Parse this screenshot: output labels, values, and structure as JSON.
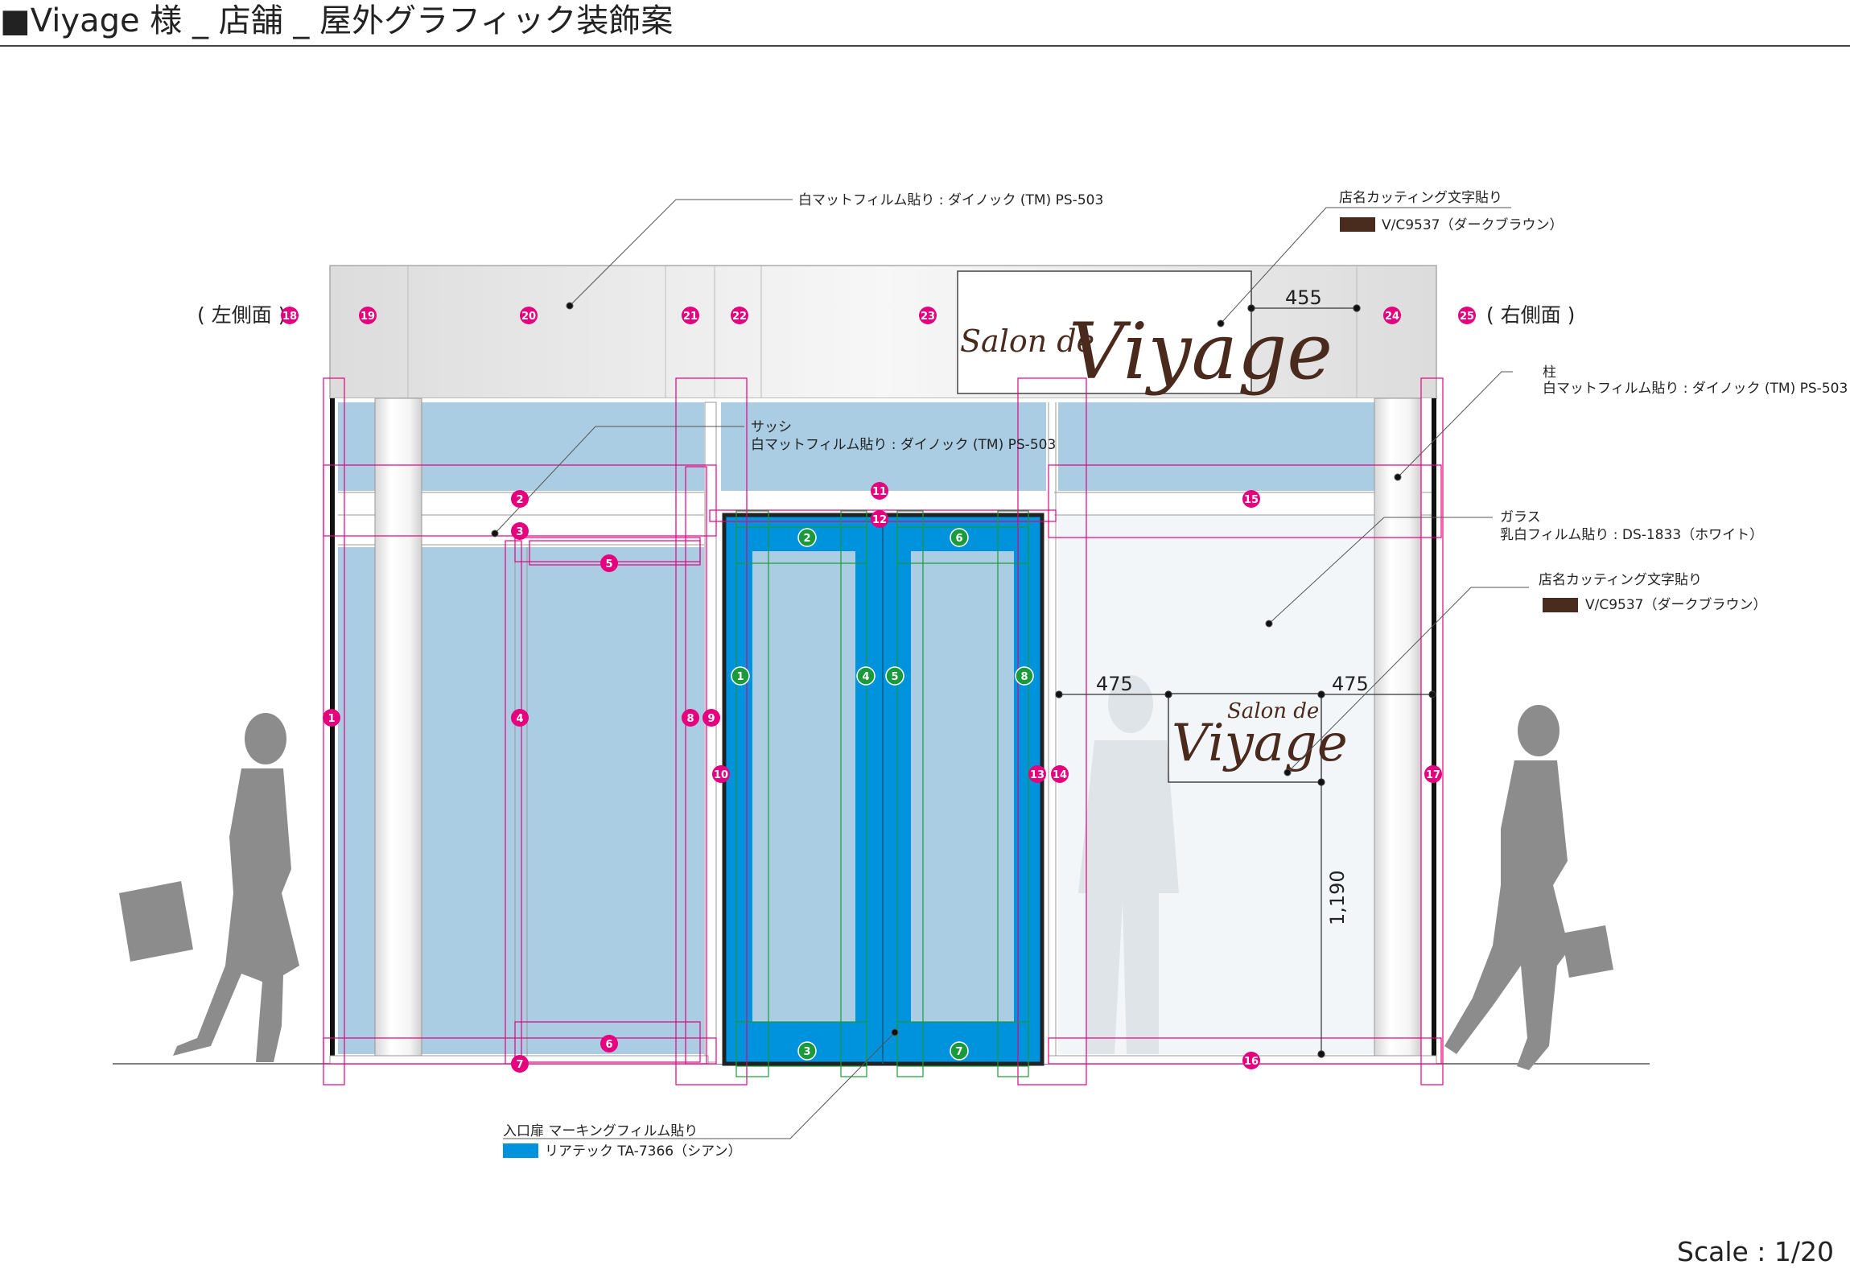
{
  "title": "■Viyage 様 _ 店舗 _ 屋外グラフィック装飾案",
  "scale": "Scale : 1/20",
  "sides": {
    "left": "( 左側面 )",
    "right": "( 右側面 )"
  },
  "callouts": {
    "sign_board": "白マットフィルム貼り : ダイノック (TM) PS-503",
    "store_name_top": {
      "title": "店名カッティング文字貼り",
      "item": "V/C9537（ダークブラウン）"
    },
    "pillar": {
      "title": "柱",
      "item": "白マットフィルム貼り : ダイノック (TM) PS-503"
    },
    "sash": {
      "title": "サッシ",
      "item": "白マットフィルム貼り : ダイノック (TM) PS-503"
    },
    "glass": {
      "title": "ガラス",
      "item": "乳白フィルム貼り : DS-1833（ホワイト）"
    },
    "store_name_glass": {
      "title": "店名カッティング文字貼り",
      "item": "V/C9537（ダークブラウン）"
    },
    "door": {
      "title": "入口扉 マーキングフィルム貼り",
      "item": "リアテック TA-7366（シアン）"
    }
  },
  "logo": {
    "small": "Salon de",
    "main": "Viyage"
  },
  "dimensions": {
    "top_gap": "455",
    "left_gap": "475",
    "right_gap": "475",
    "height": "1,190"
  },
  "colors": {
    "dark_brown": "#4a2c1e",
    "cyan": "#0093dd",
    "pink_marker": "#e6007e",
    "green_marker": "#1a9a3a",
    "light_blue_glass": "#aacde3",
    "frosted_glass": "#f3f6f9"
  },
  "pink_markers": [
    "1",
    "2",
    "3",
    "4",
    "5",
    "6",
    "7",
    "8",
    "9",
    "10",
    "11",
    "12",
    "13",
    "14",
    "15",
    "16",
    "17",
    "18",
    "19",
    "20",
    "21",
    "22",
    "23",
    "24",
    "25"
  ],
  "green_markers": [
    "1",
    "2",
    "3",
    "4",
    "5",
    "6",
    "7",
    "8"
  ]
}
